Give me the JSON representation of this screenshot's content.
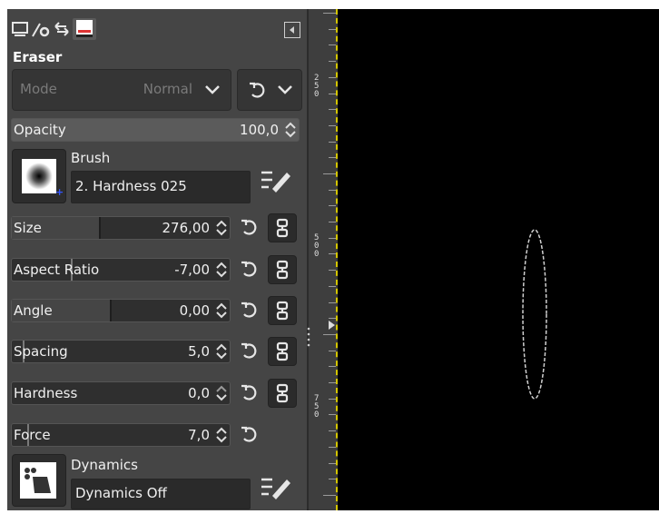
{
  "tool": {
    "title": "Eraser"
  },
  "mode": {
    "label": "Mode",
    "value": "Normal"
  },
  "opacity": {
    "label": "Opacity",
    "value": "100,0"
  },
  "brush": {
    "label": "Brush",
    "name": "2. Hardness 025"
  },
  "options": [
    {
      "label": "Size",
      "value": "276,00",
      "fill": 0.4
    },
    {
      "label": "Aspect Ratio",
      "value": "-7,00",
      "fill": 0.27
    },
    {
      "label": "Angle",
      "value": "0,00",
      "fill": 0.45
    },
    {
      "label": "Spacing",
      "value": "5,0",
      "fill": 0.05
    },
    {
      "label": "Hardness",
      "value": "0,0",
      "fill": 0.0
    },
    {
      "label": "Force",
      "value": "7,0",
      "fill": 0.07
    }
  ],
  "dynamics": {
    "label": "Dynamics",
    "name": "Dynamics Off"
  },
  "ruler": {
    "labels": [
      "250",
      "500",
      "750"
    ]
  },
  "icons": {
    "tabs": [
      "tool-options-icon",
      "device-status-icon",
      "undo-history-icon",
      "images-icon"
    ],
    "panel_menu": "panel-menu-icon"
  }
}
